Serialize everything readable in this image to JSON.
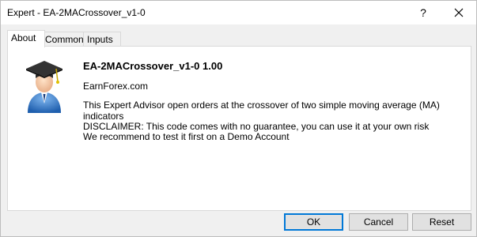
{
  "window": {
    "title": "Expert - EA-2MACrossover_v1-0",
    "help_label": "?",
    "close_icon": "close-icon"
  },
  "tabs": [
    {
      "label": "About",
      "active": true
    },
    {
      "label": "Common",
      "active": false
    },
    {
      "label": "Inputs",
      "active": false
    }
  ],
  "about": {
    "icon": "graduate-user-icon",
    "ea_title": "EA-2MACrossover_v1-0 1.00",
    "author": "EarnForex.com",
    "description": "This Expert Advisor open orders at the crossover of two simple moving average (MA) indicators",
    "disclaimer_line1": "DISCLAIMER: This code comes with no guarantee, you can use it at your own risk",
    "disclaimer_line2": "We recommend to test it first on a Demo Account"
  },
  "buttons": {
    "ok": "OK",
    "cancel": "Cancel",
    "reset": "Reset"
  },
  "colors": {
    "accent": "#0078d7",
    "avatar_blue": "#2f78c8"
  }
}
